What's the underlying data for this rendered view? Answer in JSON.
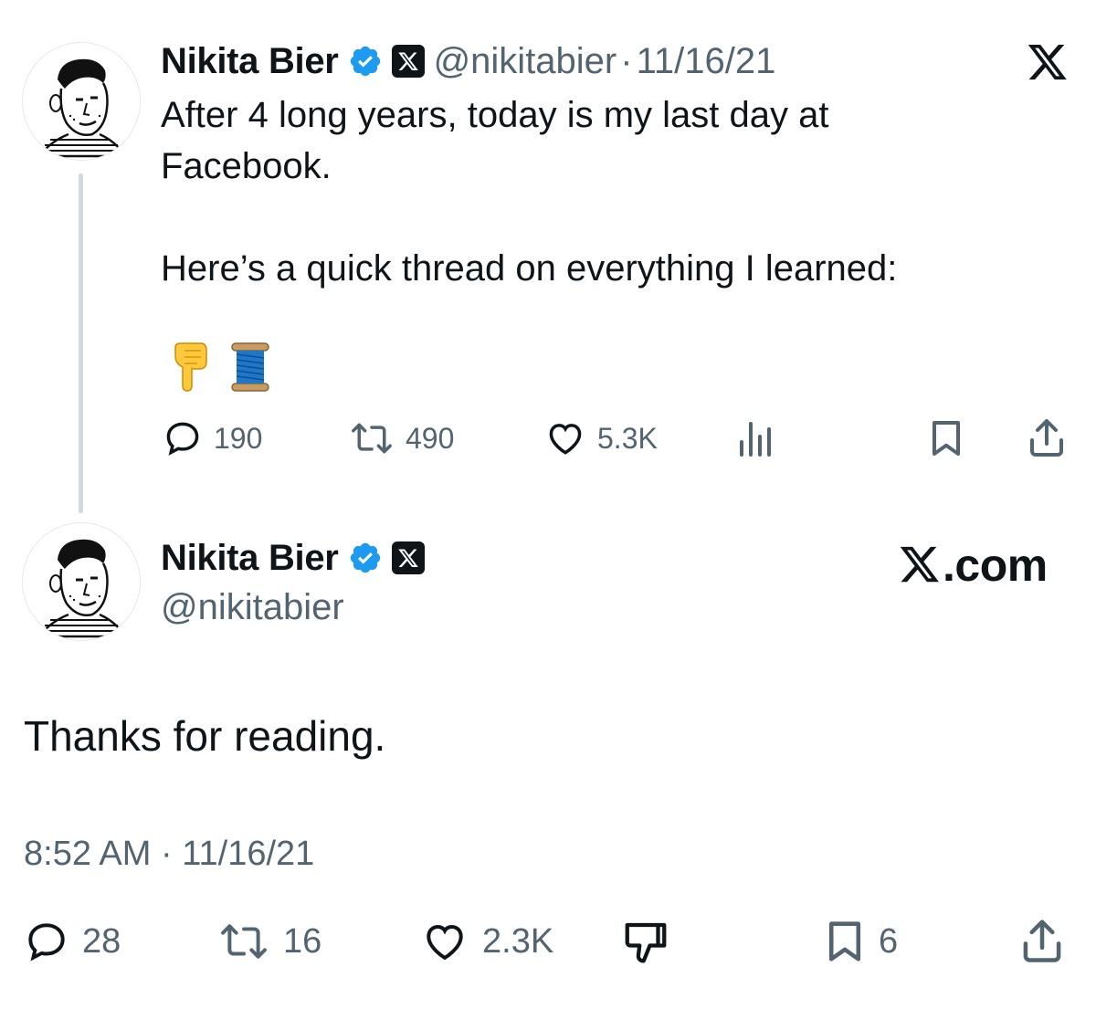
{
  "first_tweet": {
    "author_name": "Nikita Bier",
    "handle": "@nikitabier",
    "separator": "·",
    "date": "11/16/21",
    "text": "After 4 long years, today is my last day at\nFacebook.\n\nHere’s a quick thread on everything I learned:",
    "emojis": [
      "backhand-index-pointing-down",
      "spool-of-thread"
    ],
    "actions": {
      "replies": "190",
      "retweets": "490",
      "likes": "5.3K"
    }
  },
  "second_tweet": {
    "author_name": "Nikita Bier",
    "handle": "@nikitabier",
    "brand": "X.com",
    "text": "Thanks for reading.",
    "timestamp": "8:52 AM · 11/16/21",
    "actions": {
      "replies": "28",
      "retweets": "16",
      "likes": "2.3K",
      "bookmarks": "6"
    }
  },
  "colors": {
    "text": "#0f1419",
    "secondary": "#536471",
    "verified": "#1d9bf0",
    "thread_line": "#cfd9de"
  },
  "icons": [
    "x-logo-icon",
    "verified-badge-icon",
    "x-affiliate-icon",
    "reply-icon",
    "retweet-icon",
    "like-icon",
    "views-icon",
    "bookmark-icon",
    "share-icon",
    "downvote-icon"
  ]
}
